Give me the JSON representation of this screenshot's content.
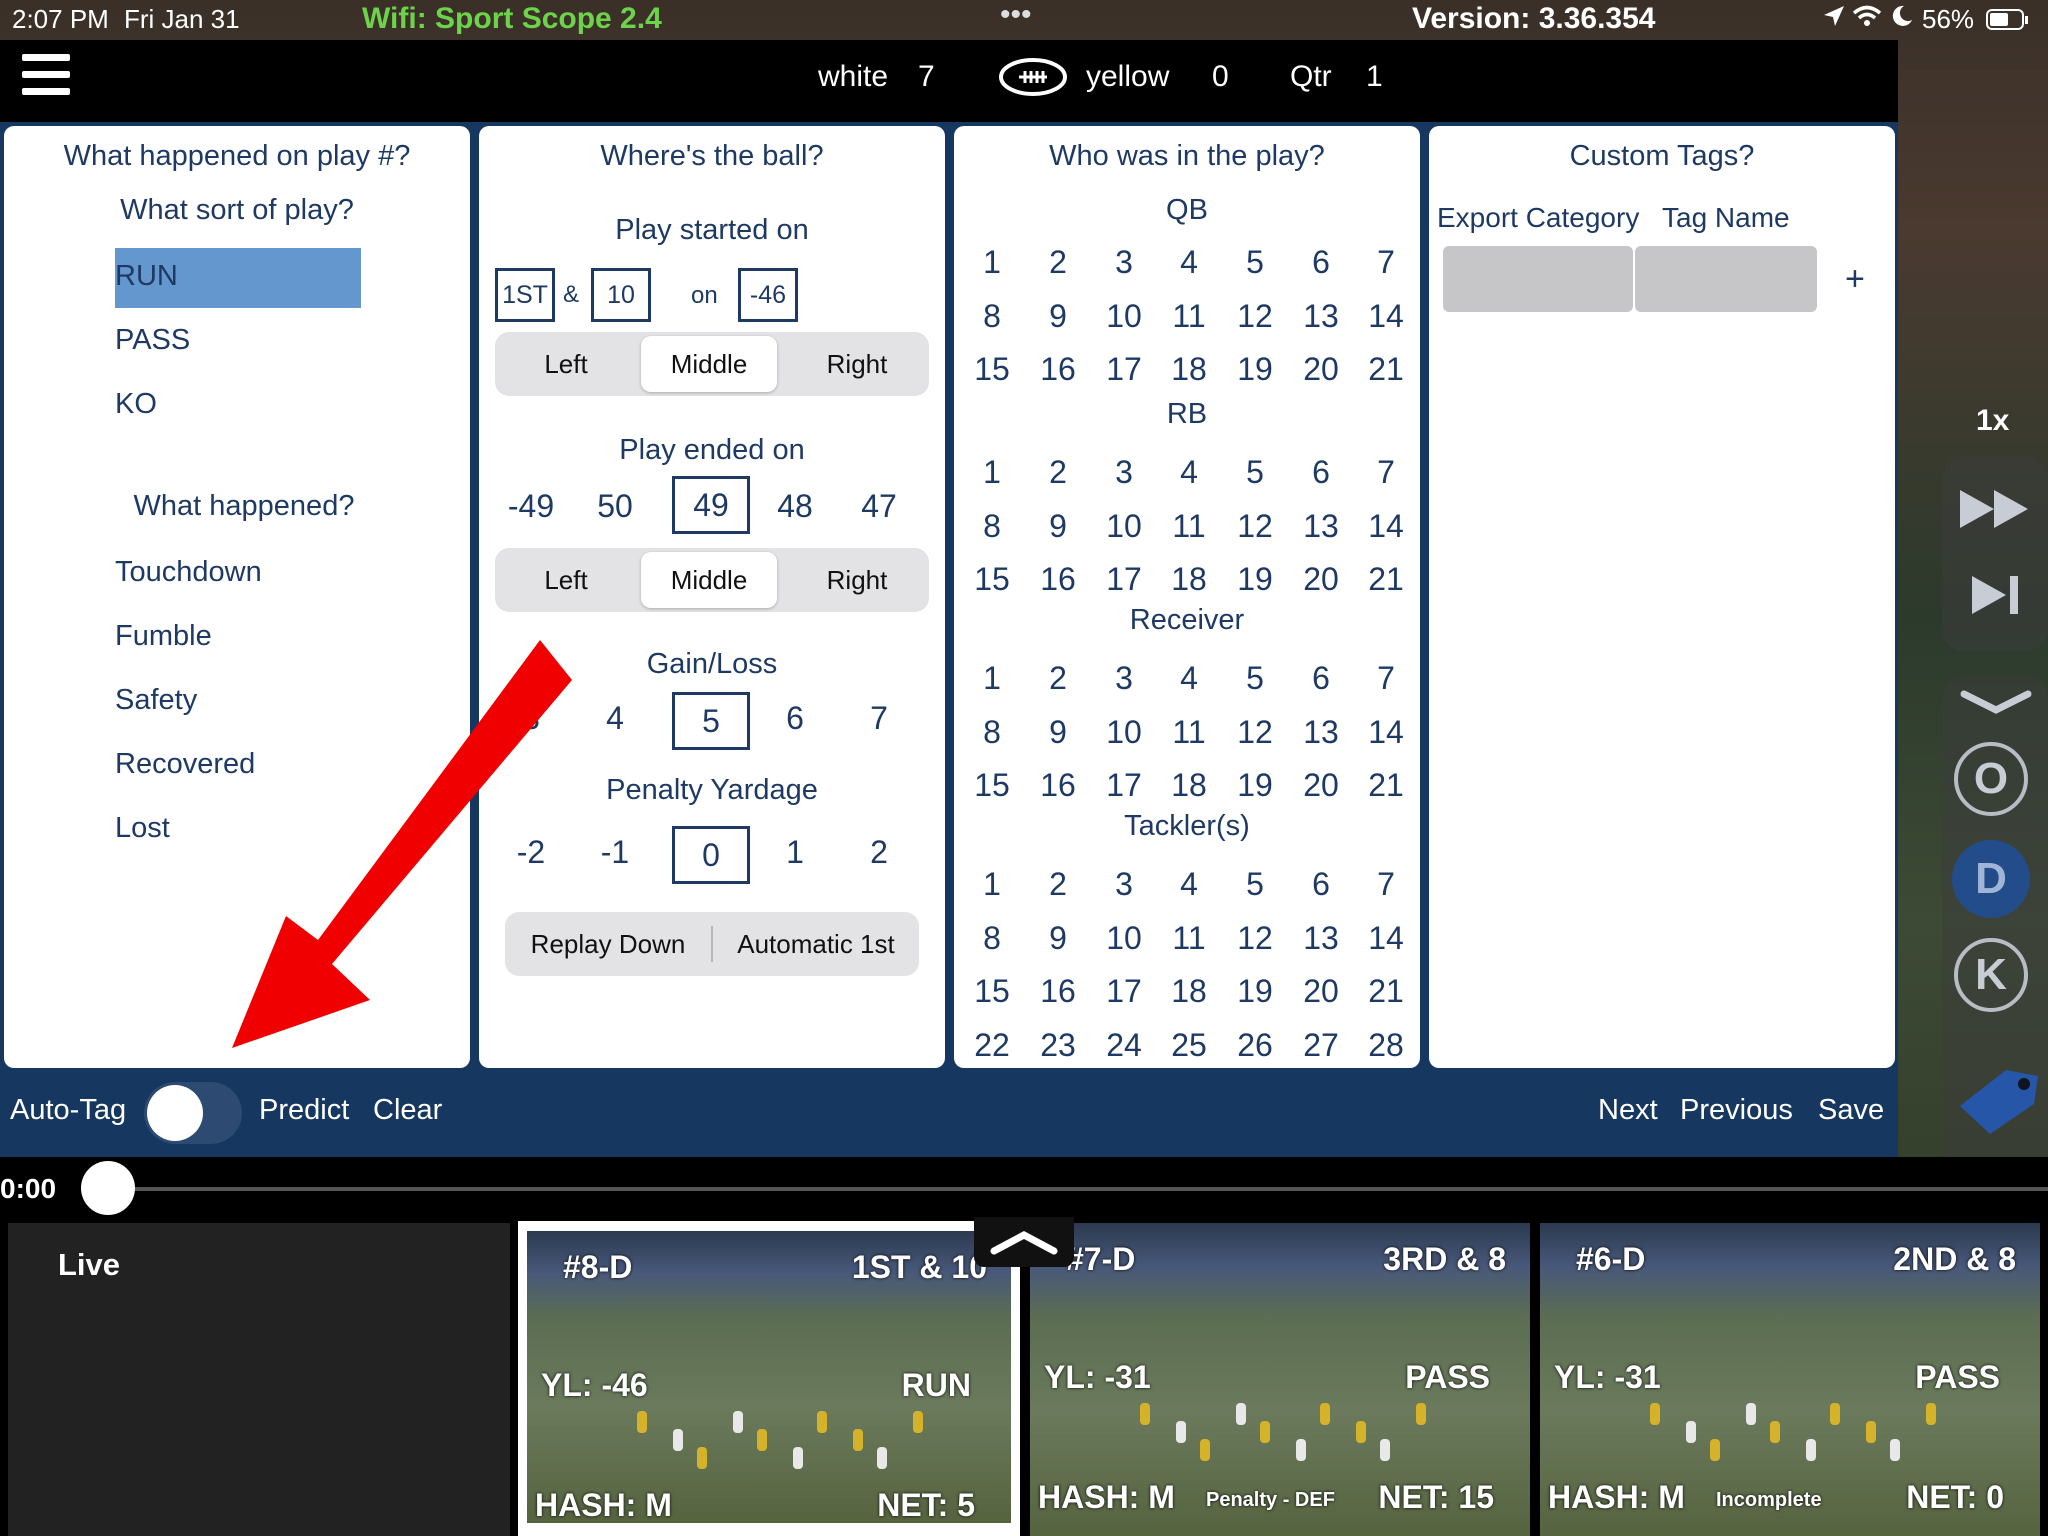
{
  "status_bar": {
    "time": "2:07 PM",
    "date": "Fri Jan 31",
    "wifi": "Wifi: Sport Scope 2.4",
    "version": "Version: 3.36.354",
    "battery": "56%"
  },
  "scoreboard": {
    "team1": "white",
    "score1": "7",
    "team2": "yellow",
    "score2": "0",
    "qtr_label": "Qtr",
    "qtr_value": "1"
  },
  "panel1": {
    "title": "What happened on play #?",
    "sort_label": "What sort of play?",
    "play_types": [
      "RUN",
      "PASS",
      "KO"
    ],
    "selected_play_type": "RUN",
    "happened_label": "What happened?",
    "outcomes": [
      "Touchdown",
      "Fumble",
      "Safety",
      "Recovered",
      "Lost"
    ]
  },
  "panel2": {
    "title": "Where's the ball?",
    "started_label": "Play started on",
    "down": "1ST",
    "amp": "&",
    "distance": "10",
    "on_label": "on",
    "start_yard": "-46",
    "hash_options": [
      "Left",
      "Middle",
      "Right"
    ],
    "hash_selected": "Middle",
    "ended_label": "Play ended on",
    "end_yards": [
      "-49",
      "50",
      "49",
      "48",
      "47"
    ],
    "end_selected": "49",
    "hash2_options": [
      "Left",
      "Middle",
      "Right"
    ],
    "hash2_selected": "Middle",
    "gain_label": "Gain/Loss",
    "gain_values": [
      "3",
      "4",
      "5",
      "6",
      "7"
    ],
    "gain_selected": "5",
    "penalty_label": "Penalty Yardage",
    "penalty_values": [
      "-2",
      "-1",
      "0",
      "1",
      "2"
    ],
    "penalty_selected": "0",
    "replay_down": "Replay Down",
    "auto_first": "Automatic 1st"
  },
  "panel3": {
    "title": "Who was in the play?",
    "groups": [
      {
        "label": "QB",
        "numbers": [
          "1",
          "2",
          "3",
          "4",
          "5",
          "6",
          "7",
          "8",
          "9",
          "10",
          "11",
          "12",
          "13",
          "14",
          "15",
          "16",
          "17",
          "18",
          "19",
          "20",
          "21"
        ]
      },
      {
        "label": "RB",
        "numbers": [
          "1",
          "2",
          "3",
          "4",
          "5",
          "6",
          "7",
          "8",
          "9",
          "10",
          "11",
          "12",
          "13",
          "14",
          "15",
          "16",
          "17",
          "18",
          "19",
          "20",
          "21"
        ]
      },
      {
        "label": "Receiver",
        "numbers": [
          "1",
          "2",
          "3",
          "4",
          "5",
          "6",
          "7",
          "8",
          "9",
          "10",
          "11",
          "12",
          "13",
          "14",
          "15",
          "16",
          "17",
          "18",
          "19",
          "20",
          "21"
        ]
      },
      {
        "label": "Tackler(s)",
        "numbers": [
          "1",
          "2",
          "3",
          "4",
          "5",
          "6",
          "7",
          "8",
          "9",
          "10",
          "11",
          "12",
          "13",
          "14",
          "15",
          "16",
          "17",
          "18",
          "19",
          "20",
          "21",
          "22",
          "23",
          "24",
          "25",
          "26",
          "27",
          "28"
        ]
      }
    ]
  },
  "panel4": {
    "title": "Custom Tags?",
    "col1": "Export Category",
    "col2": "Tag Name",
    "add": "+"
  },
  "bottom_bar": {
    "auto_tag": "Auto-Tag",
    "predict": "Predict",
    "clear": "Clear",
    "next": "Next",
    "previous": "Previous",
    "save": "Save"
  },
  "player": {
    "time": "0:00",
    "speed": "1x",
    "letters": [
      "O",
      "D",
      "K"
    ]
  },
  "thumbnails": {
    "live": "Live",
    "clips": [
      {
        "id": "#8-D",
        "down": "1ST & 10",
        "yl": "YL: -46",
        "type": "RUN",
        "hash": "HASH: M",
        "note": "",
        "net": "NET: 5"
      },
      {
        "id": "#7-D",
        "down": "3RD & 8",
        "yl": "YL: -31",
        "type": "PASS",
        "hash": "HASH: M",
        "note": "Penalty - DEF",
        "net": "NET: 15"
      },
      {
        "id": "#6-D",
        "down": "2ND & 8",
        "yl": "YL: -31",
        "type": "PASS",
        "hash": "HASH: M",
        "note": "Incomplete",
        "net": "NET: 0"
      }
    ]
  },
  "colors": {
    "panel_bg": "#16375f",
    "text_navy": "#1e3a64",
    "selected_blue": "#6497cd",
    "wifi_green": "#6dd34a",
    "arrow_red": "#f00000"
  }
}
